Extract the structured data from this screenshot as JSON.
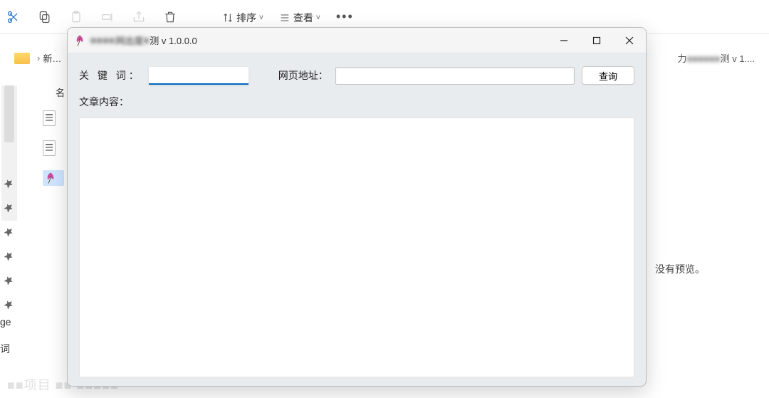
{
  "explorer": {
    "toolbar": {
      "sort_label": "排序",
      "view_label": "查看"
    },
    "breadcrumb": {
      "caret": "›",
      "current": "新…",
      "right_fragment_prefix": "力",
      "right_fragment_suffix": "测 v 1...."
    },
    "column_header": "名",
    "left_labels": {
      "l1": "ge",
      "l2": "词"
    }
  },
  "preview": {
    "empty_text": "没有预览。"
  },
  "dialog": {
    "title_blur_1": "■■■■",
    "title_mid": "网出度",
    "title_blur_2": "■",
    "title_suffix": "测 v 1.0.0.0",
    "keyword_label": "关 键 词：",
    "url_label": "网页地址：",
    "content_label": "文章内容：",
    "query_button": "查询",
    "keyword_value": "",
    "url_value": ""
  },
  "watermark": "■■项目 ■■ ■■■■■"
}
